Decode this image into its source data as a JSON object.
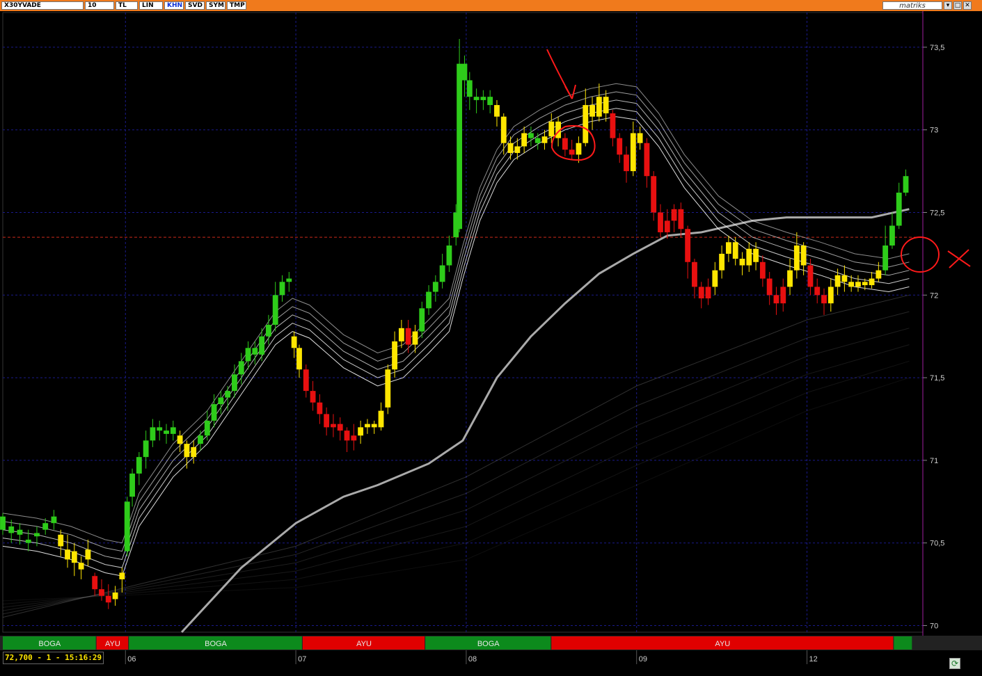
{
  "toolbar": {
    "symbol": "X30YVADE",
    "period": "10",
    "buttons": [
      "TL",
      "LIN",
      "KHN",
      "SVD",
      "SYM",
      "TMP"
    ],
    "brand": "matriks",
    "window_controls": [
      "▾",
      "□",
      "✕"
    ]
  },
  "status_readout": "72,700 - 1 - 15:16:29",
  "colors": {
    "background": "#000000",
    "toolbar": "#f07a1c",
    "grid": "#1a1a8c",
    "bull_candle": "#2ecc1a",
    "neutral_candle": "#ffe600",
    "bear_candle": "#e81010",
    "ma_lines": "#ffffff",
    "long_ma": "#aaaaaa",
    "boga_band": "#0c8a1c",
    "ayu_band": "#e00000",
    "annotation": "#ff1a1a",
    "price_line": "#cc2a1a"
  },
  "chart_data": {
    "type": "candlestick",
    "y_axis": {
      "ticks": [
        "73,5",
        "73",
        "72,5",
        "72",
        "71,5",
        "71",
        "70,5",
        "70"
      ],
      "min": 69.96,
      "max": 73.71
    },
    "x_axis": {
      "date_labels": [
        {
          "label": "06",
          "bar": 72
        },
        {
          "label": "07",
          "bar": 172
        },
        {
          "label": "08",
          "bar": 272
        },
        {
          "label": "09",
          "bar": 372
        },
        {
          "label": "12",
          "bar": 472
        }
      ],
      "total_bars": 540
    },
    "reference_price": 72.35,
    "candles": [
      [
        0,
        70.66,
        70.58,
        70.68,
        70.55,
        "g"
      ],
      [
        5,
        70.6,
        70.56,
        70.64,
        70.5,
        "g"
      ],
      [
        10,
        70.58,
        70.55,
        70.62,
        70.49,
        "g"
      ],
      [
        15,
        70.52,
        70.5,
        70.58,
        70.45,
        "g"
      ],
      [
        20,
        70.54,
        70.56,
        70.6,
        70.48,
        "g"
      ],
      [
        25,
        70.58,
        70.62,
        70.65,
        70.55,
        "g"
      ],
      [
        30,
        70.62,
        70.66,
        70.7,
        70.58,
        "g"
      ],
      [
        34,
        70.55,
        70.48,
        70.58,
        70.42,
        "y"
      ],
      [
        38,
        70.46,
        70.4,
        70.55,
        70.35,
        "y"
      ],
      [
        42,
        70.45,
        70.38,
        70.5,
        70.3,
        "y"
      ],
      [
        46,
        70.38,
        70.34,
        70.42,
        70.28,
        "y"
      ],
      [
        50,
        70.4,
        70.46,
        70.52,
        70.36,
        "y"
      ],
      [
        54,
        70.3,
        70.22,
        70.32,
        70.18,
        "r"
      ],
      [
        58,
        70.22,
        70.18,
        70.28,
        70.15,
        "r"
      ],
      [
        62,
        70.18,
        70.14,
        70.25,
        70.1,
        "r"
      ],
      [
        66,
        70.16,
        70.2,
        70.24,
        70.12,
        "y"
      ],
      [
        70,
        70.28,
        70.32,
        70.35,
        70.2,
        "y"
      ],
      [
        73,
        70.45,
        70.75,
        70.78,
        70.42,
        "g"
      ],
      [
        76,
        70.78,
        70.92,
        70.95,
        70.72,
        "g"
      ],
      [
        80,
        70.92,
        71.02,
        71.05,
        70.85,
        "g"
      ],
      [
        84,
        71.02,
        71.12,
        71.18,
        70.95,
        "g"
      ],
      [
        88,
        71.12,
        71.2,
        71.25,
        71.08,
        "g"
      ],
      [
        92,
        71.2,
        71.18,
        71.24,
        71.12,
        "g"
      ],
      [
        96,
        71.18,
        71.16,
        71.22,
        71.1,
        "g"
      ],
      [
        100,
        71.16,
        71.2,
        71.24,
        71.12,
        "g"
      ],
      [
        104,
        71.15,
        71.1,
        71.18,
        71.05,
        "y"
      ],
      [
        108,
        71.1,
        71.02,
        71.12,
        70.95,
        "y"
      ],
      [
        112,
        71.02,
        71.08,
        71.12,
        70.98,
        "y"
      ],
      [
        116,
        71.1,
        71.15,
        71.18,
        71.06,
        "g"
      ],
      [
        120,
        71.15,
        71.24,
        71.3,
        71.12,
        "g"
      ],
      [
        124,
        71.24,
        71.34,
        71.4,
        71.2,
        "g"
      ],
      [
        128,
        71.34,
        71.38,
        71.42,
        71.28,
        "g"
      ],
      [
        132,
        71.38,
        71.42,
        71.45,
        71.3,
        "g"
      ],
      [
        136,
        71.42,
        71.52,
        71.58,
        71.38,
        "g"
      ],
      [
        140,
        71.52,
        71.6,
        71.65,
        71.46,
        "g"
      ],
      [
        144,
        71.6,
        71.68,
        71.72,
        71.55,
        "g"
      ],
      [
        148,
        71.68,
        71.64,
        71.72,
        71.58,
        "g"
      ],
      [
        152,
        71.64,
        71.75,
        71.8,
        71.6,
        "g"
      ],
      [
        156,
        71.75,
        71.82,
        71.88,
        71.7,
        "g"
      ],
      [
        160,
        71.82,
        72.0,
        72.08,
        71.78,
        "g"
      ],
      [
        164,
        72.0,
        72.08,
        72.12,
        71.96,
        "g"
      ],
      [
        168,
        72.08,
        72.1,
        72.14,
        72.02,
        "g"
      ],
      [
        171,
        71.75,
        71.68,
        71.78,
        71.62,
        "y"
      ],
      [
        174,
        71.68,
        71.55,
        71.7,
        71.5,
        "y"
      ],
      [
        178,
        71.55,
        71.42,
        71.58,
        71.38,
        "r"
      ],
      [
        182,
        71.42,
        71.35,
        71.48,
        71.3,
        "r"
      ],
      [
        186,
        71.35,
        71.28,
        71.4,
        71.22,
        "r"
      ],
      [
        190,
        71.28,
        71.2,
        71.32,
        71.15,
        "r"
      ],
      [
        194,
        71.2,
        71.22,
        71.28,
        71.14,
        "r"
      ],
      [
        198,
        71.22,
        71.18,
        71.26,
        71.12,
        "r"
      ],
      [
        202,
        71.18,
        71.12,
        71.2,
        71.05,
        "r"
      ],
      [
        206,
        71.12,
        71.15,
        71.22,
        71.06,
        "r"
      ],
      [
        210,
        71.15,
        71.2,
        71.24,
        71.1,
        "y"
      ],
      [
        214,
        71.2,
        71.22,
        71.25,
        71.16,
        "y"
      ],
      [
        218,
        71.22,
        71.2,
        71.24,
        71.16,
        "y"
      ],
      [
        222,
        71.2,
        71.3,
        71.35,
        71.18,
        "y"
      ],
      [
        226,
        71.32,
        71.55,
        71.58,
        71.28,
        "y"
      ],
      [
        230,
        71.55,
        71.72,
        71.78,
        71.5,
        "y"
      ],
      [
        234,
        71.72,
        71.8,
        71.85,
        71.68,
        "y"
      ],
      [
        238,
        71.8,
        71.7,
        71.85,
        71.65,
        "r"
      ],
      [
        242,
        71.7,
        71.78,
        71.82,
        71.65,
        "y"
      ],
      [
        246,
        71.78,
        71.92,
        71.96,
        71.74,
        "g"
      ],
      [
        250,
        71.92,
        72.02,
        72.06,
        71.88,
        "g"
      ],
      [
        254,
        72.02,
        72.08,
        72.12,
        71.96,
        "g"
      ],
      [
        258,
        72.08,
        72.18,
        72.25,
        72.04,
        "g"
      ],
      [
        262,
        72.18,
        72.3,
        72.36,
        72.14,
        "g"
      ],
      [
        266,
        72.35,
        72.5,
        72.55,
        72.3,
        "g"
      ],
      [
        268,
        72.4,
        73.4,
        73.55,
        72.38,
        "g"
      ],
      [
        271,
        73.4,
        73.3,
        73.45,
        73.2,
        "g"
      ],
      [
        274,
        73.3,
        73.2,
        73.35,
        73.12,
        "g"
      ],
      [
        278,
        73.2,
        73.18,
        73.25,
        73.1,
        "g"
      ],
      [
        282,
        73.18,
        73.2,
        73.24,
        73.12,
        "g"
      ],
      [
        286,
        73.2,
        73.15,
        73.24,
        73.1,
        "g"
      ],
      [
        290,
        73.15,
        73.08,
        73.18,
        73.02,
        "y"
      ],
      [
        294,
        73.08,
        72.92,
        73.1,
        72.85,
        "y"
      ],
      [
        298,
        72.92,
        72.86,
        72.96,
        72.82,
        "y"
      ],
      [
        302,
        72.86,
        72.9,
        72.95,
        72.82,
        "y"
      ],
      [
        306,
        72.9,
        72.98,
        73.02,
        72.86,
        "y"
      ],
      [
        310,
        72.98,
        72.95,
        73.02,
        72.9,
        "g"
      ],
      [
        314,
        72.95,
        72.92,
        72.98,
        72.88,
        "g"
      ],
      [
        318,
        72.92,
        72.96,
        73.0,
        72.88,
        "y"
      ],
      [
        322,
        72.96,
        73.05,
        73.1,
        72.92,
        "y"
      ],
      [
        326,
        73.05,
        72.95,
        73.08,
        72.9,
        "y"
      ],
      [
        330,
        72.95,
        72.88,
        72.98,
        72.84,
        "r"
      ],
      [
        334,
        72.88,
        72.85,
        72.94,
        72.82,
        "r"
      ],
      [
        338,
        72.85,
        72.92,
        72.96,
        72.8,
        "y"
      ],
      [
        342,
        72.92,
        73.15,
        73.25,
        72.9,
        "y"
      ],
      [
        346,
        73.15,
        73.08,
        73.2,
        73.0,
        "y"
      ],
      [
        350,
        73.08,
        73.2,
        73.28,
        73.05,
        "y"
      ],
      [
        354,
        73.2,
        73.1,
        73.24,
        73.05,
        "y"
      ],
      [
        358,
        73.1,
        72.95,
        73.12,
        72.9,
        "r"
      ],
      [
        362,
        72.95,
        72.85,
        72.98,
        72.8,
        "r"
      ],
      [
        366,
        72.85,
        72.75,
        72.9,
        72.68,
        "r"
      ],
      [
        370,
        72.75,
        72.98,
        73.05,
        72.72,
        "y"
      ],
      [
        374,
        72.98,
        72.92,
        73.02,
        72.88,
        "y"
      ],
      [
        378,
        72.92,
        72.72,
        72.95,
        72.65,
        "r"
      ],
      [
        382,
        72.72,
        72.5,
        72.75,
        72.45,
        "r"
      ],
      [
        386,
        72.5,
        72.38,
        72.55,
        72.35,
        "r"
      ],
      [
        390,
        72.38,
        72.45,
        72.52,
        72.34,
        "r"
      ],
      [
        394,
        72.45,
        72.52,
        72.55,
        72.38,
        "r"
      ],
      [
        398,
        72.52,
        72.4,
        72.56,
        72.35,
        "r"
      ],
      [
        402,
        72.4,
        72.2,
        72.42,
        72.1,
        "r"
      ],
      [
        406,
        72.2,
        72.05,
        72.22,
        71.98,
        "r"
      ],
      [
        410,
        72.05,
        71.98,
        72.08,
        71.92,
        "r"
      ],
      [
        414,
        71.98,
        72.05,
        72.1,
        71.94,
        "r"
      ],
      [
        418,
        72.05,
        72.15,
        72.2,
        72.0,
        "y"
      ],
      [
        422,
        72.15,
        72.25,
        72.3,
        72.1,
        "y"
      ],
      [
        426,
        72.25,
        72.32,
        72.36,
        72.2,
        "y"
      ],
      [
        430,
        72.32,
        72.22,
        72.35,
        72.18,
        "y"
      ],
      [
        434,
        72.22,
        72.18,
        72.26,
        72.12,
        "y"
      ],
      [
        438,
        72.18,
        72.28,
        72.32,
        72.14,
        "y"
      ],
      [
        442,
        72.28,
        72.2,
        72.32,
        72.15,
        "y"
      ],
      [
        446,
        72.2,
        72.1,
        72.24,
        72.05,
        "r"
      ],
      [
        450,
        72.1,
        72.0,
        72.14,
        71.94,
        "r"
      ],
      [
        454,
        72.0,
        71.95,
        72.05,
        71.88,
        "r"
      ],
      [
        458,
        71.95,
        72.05,
        72.1,
        71.9,
        "r"
      ],
      [
        462,
        72.05,
        72.15,
        72.22,
        72.0,
        "y"
      ],
      [
        466,
        72.15,
        72.3,
        72.38,
        72.1,
        "y"
      ],
      [
        470,
        72.3,
        72.18,
        72.32,
        72.12,
        "y"
      ],
      [
        474,
        72.18,
        72.05,
        72.22,
        72.0,
        "r"
      ],
      [
        478,
        72.05,
        72.0,
        72.1,
        71.95,
        "r"
      ],
      [
        482,
        72.0,
        71.95,
        72.04,
        71.88,
        "r"
      ],
      [
        486,
        71.95,
        72.05,
        72.1,
        71.9,
        "y"
      ],
      [
        490,
        72.05,
        72.12,
        72.16,
        72.0,
        "y"
      ],
      [
        494,
        72.12,
        72.08,
        72.18,
        72.02,
        "y"
      ],
      [
        498,
        72.08,
        72.05,
        72.12,
        72.02,
        "y"
      ],
      [
        502,
        72.05,
        72.08,
        72.12,
        72.02,
        "y"
      ],
      [
        506,
        72.08,
        72.06,
        72.1,
        72.03,
        "y"
      ],
      [
        510,
        72.06,
        72.1,
        72.14,
        72.04,
        "y"
      ],
      [
        514,
        72.1,
        72.15,
        72.2,
        72.08,
        "y"
      ],
      [
        518,
        72.15,
        72.3,
        72.42,
        72.12,
        "g"
      ],
      [
        522,
        72.3,
        72.42,
        72.5,
        72.28,
        "g"
      ],
      [
        526,
        72.42,
        72.62,
        72.68,
        72.4,
        "g"
      ],
      [
        530,
        72.62,
        72.72,
        72.76,
        72.6,
        "g"
      ]
    ],
    "ribbon_ma": [
      [
        0,
        70.58
      ],
      [
        20,
        70.55
      ],
      [
        40,
        70.5
      ],
      [
        60,
        70.42
      ],
      [
        70,
        70.4
      ],
      [
        80,
        70.7
      ],
      [
        100,
        71.0
      ],
      [
        120,
        71.2
      ],
      [
        140,
        71.5
      ],
      [
        160,
        71.8
      ],
      [
        170,
        71.88
      ],
      [
        180,
        71.84
      ],
      [
        200,
        71.66
      ],
      [
        220,
        71.55
      ],
      [
        235,
        71.6
      ],
      [
        250,
        71.75
      ],
      [
        262,
        71.88
      ],
      [
        270,
        72.2
      ],
      [
        280,
        72.55
      ],
      [
        290,
        72.78
      ],
      [
        300,
        72.92
      ],
      [
        315,
        73.02
      ],
      [
        330,
        73.1
      ],
      [
        345,
        73.15
      ],
      [
        360,
        73.18
      ],
      [
        372,
        73.16
      ],
      [
        385,
        73.0
      ],
      [
        400,
        72.75
      ],
      [
        420,
        72.5
      ],
      [
        440,
        72.35
      ],
      [
        460,
        72.28
      ],
      [
        480,
        72.22
      ],
      [
        500,
        72.15
      ],
      [
        520,
        72.12
      ],
      [
        532,
        72.15
      ]
    ],
    "long_ma": [
      [
        105,
        69.96
      ],
      [
        140,
        70.35
      ],
      [
        172,
        70.62
      ],
      [
        200,
        70.78
      ],
      [
        220,
        70.85
      ],
      [
        250,
        70.98
      ],
      [
        270,
        71.12
      ],
      [
        290,
        71.5
      ],
      [
        310,
        71.75
      ],
      [
        330,
        71.95
      ],
      [
        350,
        72.13
      ],
      [
        370,
        72.25
      ],
      [
        390,
        72.36
      ],
      [
        410,
        72.38
      ],
      [
        440,
        72.45
      ],
      [
        460,
        72.47
      ],
      [
        480,
        72.47
      ],
      [
        510,
        72.47
      ],
      [
        532,
        72.52
      ]
    ],
    "sentiment_bands": [
      {
        "label": "BOGA",
        "from": 0,
        "to": 55,
        "sentiment": "bull"
      },
      {
        "label": "AYU",
        "from": 55,
        "to": 74,
        "sentiment": "bear"
      },
      {
        "label": "BOGA",
        "from": 74,
        "to": 176,
        "sentiment": "bull"
      },
      {
        "label": "AYU",
        "from": 176,
        "to": 248,
        "sentiment": "bear"
      },
      {
        "label": "BOGA",
        "from": 248,
        "to": 322,
        "sentiment": "bull"
      },
      {
        "label": "AYU",
        "from": 322,
        "to": 523,
        "sentiment": "bear"
      },
      {
        "label": "",
        "from": 523,
        "to": 534,
        "sentiment": "bull"
      }
    ]
  }
}
